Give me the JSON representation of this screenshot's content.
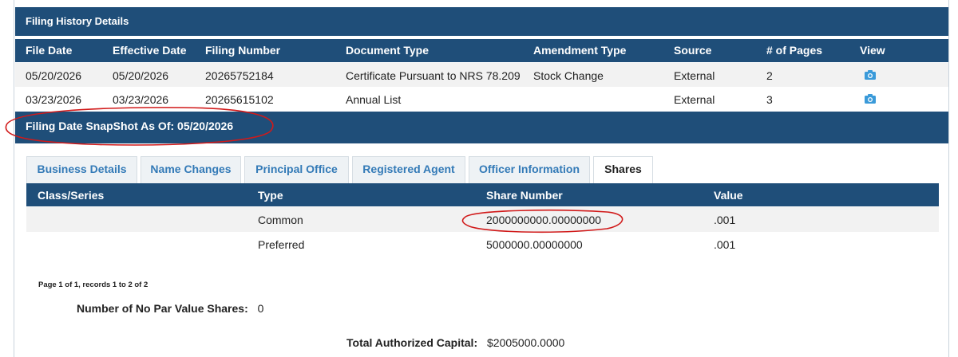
{
  "panel": {
    "title": "Filing History Details"
  },
  "history": {
    "headers": {
      "file_date": "File Date",
      "effective_date": "Effective Date",
      "filing_number": "Filing Number",
      "document_type": "Document Type",
      "amendment_type": "Amendment Type",
      "source": "Source",
      "pages": "# of Pages",
      "view": "View"
    },
    "rows": [
      {
        "file_date": "05/20/2026",
        "effective_date": "05/20/2026",
        "filing_number": "20265752184",
        "document_type": "Certificate Pursuant to NRS 78.209",
        "amendment_type": "Stock Change",
        "source": "External",
        "pages": "2",
        "view_icon": "camera-icon"
      },
      {
        "file_date": "03/23/2026",
        "effective_date": "03/23/2026",
        "filing_number": "20265615102",
        "document_type": "Annual List",
        "amendment_type": "",
        "source": "External",
        "pages": "3",
        "view_icon": "camera-icon"
      }
    ]
  },
  "snapshot": {
    "label": "Filing Date SnapShot As Of: 05/20/2026"
  },
  "tabs": [
    {
      "label": "Business Details",
      "active": false
    },
    {
      "label": "Name Changes",
      "active": false
    },
    {
      "label": "Principal Office",
      "active": false
    },
    {
      "label": "Registered Agent",
      "active": false
    },
    {
      "label": "Officer Information",
      "active": false
    },
    {
      "label": "Shares",
      "active": true
    }
  ],
  "shares": {
    "headers": {
      "class_series": "Class/Series",
      "type": "Type",
      "share_number": "Share Number",
      "value": "Value"
    },
    "rows": [
      {
        "class_series": "",
        "type": "Common",
        "share_number": "2000000000.00000000",
        "value": ".001"
      },
      {
        "class_series": "",
        "type": "Preferred",
        "share_number": "5000000.00000000",
        "value": ".001"
      }
    ]
  },
  "pager": {
    "text": "Page 1 of 1, records 1 to 2 of 2"
  },
  "no_par": {
    "label": "Number of No Par Value Shares:",
    "value": "0"
  },
  "total_capital": {
    "label": "Total Authorized Capital:",
    "value": "$2005000.0000"
  },
  "colors": {
    "header_bg": "#1f4e79",
    "link": "#337ab7",
    "row_alt": "#f2f2f2",
    "annotation": "#d11a1a"
  }
}
